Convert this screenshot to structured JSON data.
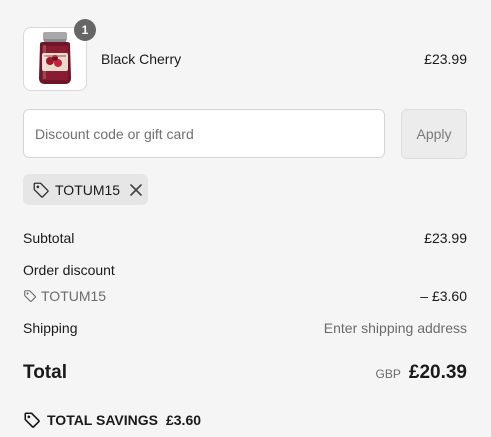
{
  "product": {
    "name": "Black Cherry",
    "price": "£23.99",
    "quantity": "1",
    "image": "candle-jar-image"
  },
  "discount": {
    "placeholder": "Discount code or gift card",
    "apply_label": "Apply",
    "applied_code": "TOTUM15"
  },
  "summary": {
    "subtotal_label": "Subtotal",
    "subtotal_value": "£23.99",
    "order_discount_label": "Order discount",
    "order_discount_code": "TOTUM15",
    "order_discount_value": "– £3.60",
    "shipping_label": "Shipping",
    "shipping_value": "Enter shipping address",
    "total_label": "Total",
    "currency": "GBP",
    "total_value": "£20.39"
  },
  "savings": {
    "label": "TOTAL SAVINGS",
    "value": "£3.60"
  },
  "icons": {
    "tag": "tag-icon",
    "close": "close-icon"
  },
  "colors": {
    "background": "#f5f5f5",
    "badge": "#666666",
    "muted": "#6b6b6b"
  }
}
